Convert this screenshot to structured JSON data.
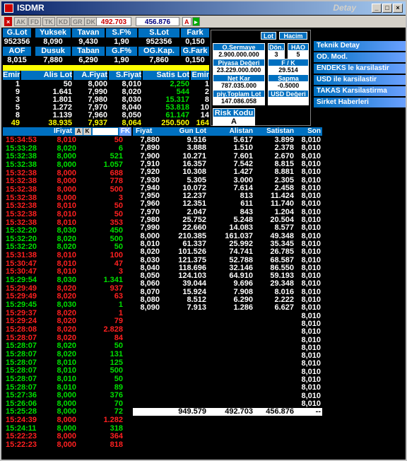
{
  "window": {
    "title": "ISDMR",
    "subtitle": "Detay"
  },
  "toolbar": {
    "buttons": [
      "AK",
      "FD",
      "TK",
      "KD",
      "GR",
      "DK"
    ],
    "price_box": "492.703",
    "value_box": "456.876",
    "a_button": "A"
  },
  "summary": {
    "headers1": [
      "G.Lot",
      "Yuksek",
      "Tavan",
      "S.F%",
      "S.Lot",
      "Fark"
    ],
    "values1": [
      "952356",
      "8,090",
      "9,430",
      "1,90",
      "952356",
      "0,150"
    ],
    "headers2": [
      "AOF",
      "Dusuk",
      "Taban",
      "G.F%",
      "OG.Kap.",
      "G.Fark"
    ],
    "values2": [
      "8,015",
      "7,880",
      "6,290",
      "1,90",
      "7,860",
      "0,150"
    ],
    "depth_headers": [
      "Emir",
      "Alis Lot",
      "A.Fiyat",
      "S.Fiyat",
      "Satis Lot",
      "Emir"
    ],
    "depth_rows": [
      [
        "1",
        "50",
        "8,000",
        "8,010",
        "2,250",
        "1"
      ],
      [
        "9",
        "1.641",
        "7,990",
        "8,020",
        "544",
        "2"
      ],
      [
        "3",
        "1.801",
        "7,980",
        "8,030",
        "15.317",
        "8"
      ],
      [
        "5",
        "1.272",
        "7,970",
        "8,040",
        "53.818",
        "10"
      ],
      [
        "8",
        "1.139",
        "7,960",
        "8,050",
        "61.147",
        "14"
      ]
    ],
    "depth_total": [
      "49",
      "38.935",
      "7,937",
      "8,064",
      "250.500",
      "164"
    ]
  },
  "info": {
    "lot_btn": "Lot",
    "hacim_btn": "Hacim",
    "sermaye_label": "O.Sermaye",
    "sermaye_value": "2.900.000.000",
    "don_label": "Dön.",
    "don_value": "3",
    "hao_label": "HAO",
    "hao_value": "5",
    "piyasa_label": "Piyasa Değeri",
    "piyasa_value": "23.229.000.000",
    "fk_label": "F / K",
    "fk_value": "29.514",
    "netkar_label": "Net Kar",
    "netkar_value": "787.035.000",
    "sapma_label": "Sapma",
    "sapma_value": "-0.5000",
    "toplam_label": "piy.Toplam Lot",
    "toplam_value": "147.086.058",
    "usd_label": "USD Değeri",
    "risk_label": "Risk Kodu",
    "risk_value": "A"
  },
  "menu": [
    "Teknik Detay",
    "OD. Mod.",
    "ENDEKS le karsilastir",
    "USD ile karsilastir",
    "TAKAS Karsilastirma",
    "Sirket Haberleri"
  ],
  "tape_header": {
    "time": "",
    "price": "IFiyat",
    "a": "A",
    "k": "K",
    "lot": "",
    "fk": "FK"
  },
  "tape": [
    [
      "15:34:53",
      "8,010",
      "50",
      "r"
    ],
    [
      "15:33:28",
      "8,020",
      "6",
      "g"
    ],
    [
      "15:32:38",
      "8,000",
      "521",
      "g"
    ],
    [
      "15:32:38",
      "8,000",
      "1.057",
      "g"
    ],
    [
      "15:32:38",
      "8,000",
      "688",
      "r"
    ],
    [
      "15:32:38",
      "8,000",
      "778",
      "r"
    ],
    [
      "15:32:38",
      "8,000",
      "500",
      "r"
    ],
    [
      "15:32:38",
      "8,000",
      "3",
      "r"
    ],
    [
      "15:32:38",
      "8,010",
      "50",
      "r"
    ],
    [
      "15:32:38",
      "8,010",
      "50",
      "r"
    ],
    [
      "15:32:38",
      "8,010",
      "353",
      "r"
    ],
    [
      "15:32:20",
      "8,030",
      "450",
      "g"
    ],
    [
      "15:32:20",
      "8,020",
      "500",
      "g"
    ],
    [
      "15:32:20",
      "8,020",
      "50",
      "g"
    ],
    [
      "15:31:38",
      "8,010",
      "100",
      "r"
    ],
    [
      "15:30:47",
      "8,010",
      "47",
      "r"
    ],
    [
      "15:30:47",
      "8,010",
      "3",
      "r"
    ],
    [
      "15:29:54",
      "8,030",
      "1.341",
      "g"
    ],
    [
      "15:29:49",
      "8,020",
      "937",
      "r"
    ],
    [
      "15:29:49",
      "8,020",
      "63",
      "r"
    ],
    [
      "15:29:45",
      "8,030",
      "1",
      "g"
    ],
    [
      "15:29:37",
      "8,020",
      "1",
      "r"
    ],
    [
      "15:29:24",
      "8,020",
      "79",
      "r"
    ],
    [
      "15:28:08",
      "8,020",
      "2.828",
      "r"
    ],
    [
      "15:28:07",
      "8,020",
      "84",
      "r"
    ],
    [
      "15:28:07",
      "8,020",
      "50",
      "g"
    ],
    [
      "15:28:07",
      "8,020",
      "131",
      "g"
    ],
    [
      "15:28:07",
      "8,010",
      "125",
      "g"
    ],
    [
      "15:28:07",
      "8,010",
      "500",
      "g"
    ],
    [
      "15:28:07",
      "8,010",
      "50",
      "g"
    ],
    [
      "15:28:07",
      "8,010",
      "89",
      "g"
    ],
    [
      "15:27:36",
      "8,000",
      "376",
      "g"
    ],
    [
      "15:26:06",
      "8,000",
      "70",
      "g"
    ],
    [
      "15:25:28",
      "8,000",
      "72",
      "g"
    ],
    [
      "15:24:39",
      "8,000",
      "1.282",
      "r"
    ],
    [
      "15:24:11",
      "8,000",
      "318",
      "g"
    ],
    [
      "15:22:23",
      "8,000",
      "364",
      "r"
    ],
    [
      "15:22:23",
      "8,000",
      "818",
      "r"
    ]
  ],
  "grid_header": [
    "Fiyat",
    "Gun Lot",
    "Alistan",
    "Satistan",
    "Son"
  ],
  "grid": [
    [
      "7,880",
      "9.516",
      "5.617",
      "3.899",
      "8,010"
    ],
    [
      "7,890",
      "3.888",
      "1.510",
      "2.378",
      "8,010"
    ],
    [
      "7,900",
      "10.271",
      "7.601",
      "2.670",
      "8,010"
    ],
    [
      "7,910",
      "16.357",
      "7.542",
      "8.815",
      "8,010"
    ],
    [
      "7,920",
      "10.308",
      "1.427",
      "8.881",
      "8,010"
    ],
    [
      "7,930",
      "5.305",
      "3.000",
      "2.305",
      "8,010"
    ],
    [
      "7,940",
      "10.072",
      "7.614",
      "2.458",
      "8,010"
    ],
    [
      "7,950",
      "12.237",
      "813",
      "11.424",
      "8,010"
    ],
    [
      "7,960",
      "12.351",
      "611",
      "11.740",
      "8,010"
    ],
    [
      "7,970",
      "2.047",
      "843",
      "1.204",
      "8,010"
    ],
    [
      "7,980",
      "25.752",
      "5.248",
      "20.504",
      "8,010"
    ],
    [
      "7,990",
      "22.660",
      "14.083",
      "8.577",
      "8,010"
    ],
    [
      "8,000",
      "210.385",
      "161.037",
      "49.348",
      "8,010"
    ],
    [
      "8,010",
      "61.337",
      "25.992",
      "35.345",
      "8,010"
    ],
    [
      "8,020",
      "101.526",
      "74.741",
      "26.785",
      "8,010"
    ],
    [
      "8,030",
      "121.375",
      "52.788",
      "68.587",
      "8,010"
    ],
    [
      "8,040",
      "118.696",
      "32.146",
      "86.550",
      "8,010"
    ],
    [
      "8,050",
      "124.103",
      "64.910",
      "59.193",
      "8,010"
    ],
    [
      "8,060",
      "39.044",
      "9.696",
      "29.348",
      "8,010"
    ],
    [
      "8,070",
      "15.924",
      "7.908",
      "8.016",
      "8,010"
    ],
    [
      "8,080",
      "8.512",
      "6.290",
      "2.222",
      "8,010"
    ],
    [
      "8,090",
      "7.913",
      "1.286",
      "6.627",
      "8,010"
    ],
    [
      "",
      "",
      "",
      "",
      "8,010"
    ],
    [
      "",
      "",
      "",
      "",
      "8,010"
    ],
    [
      "",
      "",
      "",
      "",
      "8,010"
    ],
    [
      "",
      "",
      "",
      "",
      "8,010"
    ],
    [
      "",
      "",
      "",
      "",
      "8,010"
    ],
    [
      "",
      "",
      "",
      "",
      "8,010"
    ],
    [
      "",
      "",
      "",
      "",
      "8,010"
    ],
    [
      "",
      "",
      "",
      "",
      "8,010"
    ],
    [
      "",
      "",
      "",
      "",
      "8,010"
    ],
    [
      "",
      "",
      "",
      "",
      "8,010"
    ],
    [
      "",
      "",
      "",
      "",
      "8,010"
    ],
    [
      "",
      "",
      "",
      "",
      "8,010"
    ]
  ],
  "totals": [
    "949.579",
    "492.703",
    "456.876",
    "--"
  ],
  "colors": {
    "green": "#00e000",
    "red": "#ff2020",
    "yellow": "#ffff00",
    "blue": "#0070c0"
  }
}
